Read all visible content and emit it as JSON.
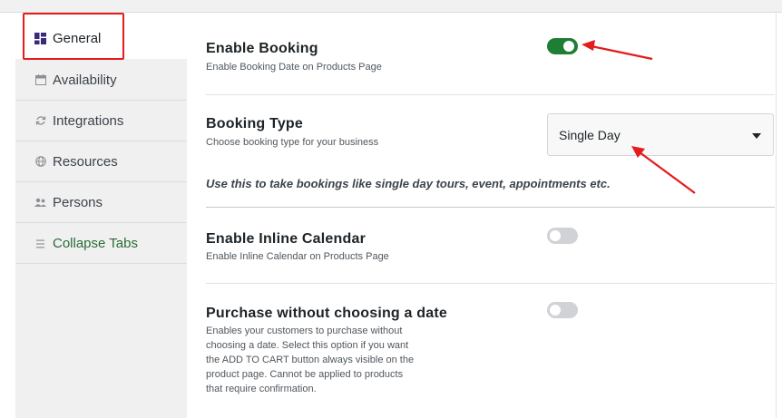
{
  "sidebar": {
    "items": [
      {
        "label": "General",
        "icon": "dashboard-icon"
      },
      {
        "label": "Availability",
        "icon": "calendar-icon"
      },
      {
        "label": "Integrations",
        "icon": "sync-icon"
      },
      {
        "label": "Resources",
        "icon": "globe-icon"
      },
      {
        "label": "Persons",
        "icon": "persons-icon"
      },
      {
        "label": "Collapse Tabs",
        "icon": "menu-icon"
      }
    ]
  },
  "settings": {
    "enable_booking": {
      "title": "Enable Booking",
      "desc": "Enable Booking Date on Products Page",
      "enabled": true
    },
    "booking_type": {
      "title": "Booking Type",
      "desc": "Choose booking type for your business",
      "selected": "Single Day",
      "note": "Use this to take bookings like single day tours, event, appointments etc."
    },
    "inline_calendar": {
      "title": "Enable Inline Calendar",
      "desc": "Enable Inline Calendar on Products Page",
      "enabled": false
    },
    "purchase_without_date": {
      "title": "Purchase without choosing a date",
      "desc_lines": [
        "Enables your customers to purchase without",
        "choosing a date. Select this option if you want",
        "the ADD TO CART button always visible on the",
        "product page. Cannot be applied to products",
        "that require confirmation."
      ],
      "enabled": false
    }
  },
  "colors": {
    "toggle_on": "#1e7e34",
    "toggle_off": "#d0d2d6",
    "annotation": "#e41c1c",
    "collapse_link": "#2a6b35"
  }
}
